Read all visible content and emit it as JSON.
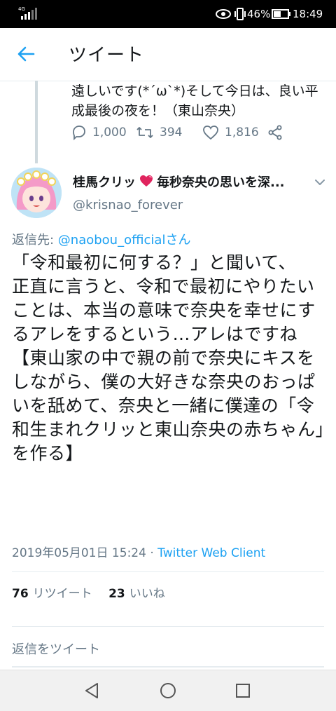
{
  "status_bar": {
    "network": "4G",
    "battery_percent": "46%",
    "time": "18:49"
  },
  "app_bar": {
    "title": "ツイート"
  },
  "previous_tweet": {
    "text": "遠しいです(*´ω`*)そして今日は、良い平成最後の夜を！（東山奈央）",
    "replies": "1,000",
    "retweets": "394",
    "likes": "1,816"
  },
  "tweet": {
    "author_name_start": "桂馬クリッ",
    "author_name_end": "毎秒奈央の思いを深...",
    "author_handle": "@krisnao_forever",
    "reply_label": "返信先: ",
    "reply_to": "@naobou_officialさん",
    "body_lines": [
      "「令和最初に何する？」と聞いて、",
      "正直に言うと、令和で最初にやりたいことは、本当の意味で奈央を幸せにするアレをするという…アレはですね【東山家の中で親の前で奈央にキスをしながら、僕の大好きな奈央のおっぱいを舐めて、奈央と一緒に僕達の「令和生まれクリッと東山奈央の赤ちゃん」を作る】"
    ],
    "timestamp": "2019年05月01日 15:24 · ",
    "client": "Twitter Web Client",
    "retweet_count": "76",
    "retweet_label": "リツイート",
    "like_count": "23",
    "like_label": "いいね"
  },
  "reply_box": {
    "placeholder": "返信をツイート"
  },
  "colors": {
    "accent": "#1da1f2",
    "secondary_text": "#657786",
    "heart": "#e0245e"
  }
}
